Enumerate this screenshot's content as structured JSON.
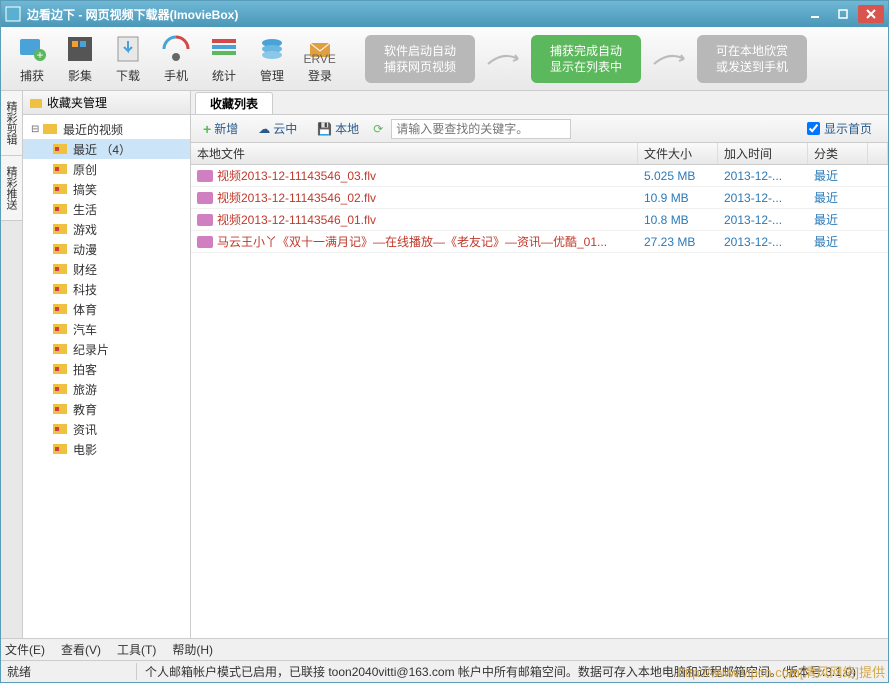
{
  "titlebar": {
    "text": "边看边下 - 网页视频下载器(ImovieBox)"
  },
  "toolbar": [
    {
      "label": "捕获",
      "icon": "capture"
    },
    {
      "label": "影集",
      "icon": "album"
    },
    {
      "label": "下载",
      "icon": "download"
    },
    {
      "label": "手机",
      "icon": "phone"
    },
    {
      "label": "统计",
      "icon": "stats"
    },
    {
      "label": "管理",
      "icon": "manage"
    },
    {
      "label": "登录",
      "icon": "login"
    }
  ],
  "flow": [
    {
      "line1": "软件启动自动",
      "line2": "捕获网页视频",
      "style": "gray"
    },
    {
      "line1": "捕获完成自动",
      "line2": "显示在列表中",
      "style": "green"
    },
    {
      "line1": "可在本地欣赏",
      "line2": "或发送到手机",
      "style": "gray"
    }
  ],
  "side_tabs": [
    "精彩剪辑",
    "精彩推送"
  ],
  "sidebar": {
    "header": "收藏夹管理",
    "root": {
      "label": "最近的视频"
    },
    "items": [
      {
        "label": "最近 （4）",
        "selected": true
      },
      {
        "label": "原创"
      },
      {
        "label": "搞笑"
      },
      {
        "label": "生活"
      },
      {
        "label": "游戏"
      },
      {
        "label": "动漫"
      },
      {
        "label": "财经"
      },
      {
        "label": "科技"
      },
      {
        "label": "体育"
      },
      {
        "label": "汽车"
      },
      {
        "label": "纪录片"
      },
      {
        "label": "拍客"
      },
      {
        "label": "旅游"
      },
      {
        "label": "教育"
      },
      {
        "label": "资讯"
      },
      {
        "label": "电影"
      }
    ]
  },
  "tabs": {
    "active": "收藏列表"
  },
  "sub_toolbar": {
    "add": "新增",
    "cloud": "云中",
    "local": "本地",
    "search_placeholder": "请输入要查找的关键字。",
    "show_home": "显示首页"
  },
  "columns": {
    "name": "本地文件",
    "size": "文件大小",
    "time": "加入时间",
    "cat": "分类"
  },
  "rows": [
    {
      "name": "视频2013-12-11143546_03.flv",
      "size": "5.025 MB",
      "time": "2013-12-...",
      "cat": "最近"
    },
    {
      "name": "视频2013-12-11143546_02.flv",
      "size": "10.9 MB",
      "time": "2013-12-...",
      "cat": "最近"
    },
    {
      "name": "视频2013-12-11143546_01.flv",
      "size": "10.8 MB",
      "time": "2013-12-...",
      "cat": "最近"
    },
    {
      "name": "马云王小丫《双十一满月记》—在线播放—《老友记》—资讯—优酷_01...",
      "size": "27.23 MB",
      "time": "2013-12-...",
      "cat": "最近"
    }
  ],
  "menubar": [
    "文件(E)",
    "查看(V)",
    "工具(T)",
    "帮助(H)"
  ],
  "statusbar": {
    "left": "就绪",
    "right": "个人邮箱帐户模式已启用，已联接 toon2040vitti@163.com 帐户中所有邮箱空间。数据可存入本地电脑和远程邮箱空间。(版本号:3.1.0)"
  },
  "watermark": "http://www.vipcn.com[清风网络]提供"
}
